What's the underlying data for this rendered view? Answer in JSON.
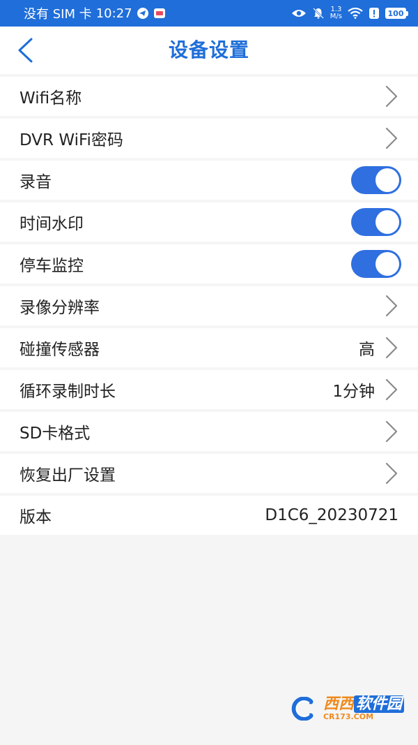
{
  "status_bar": {
    "carrier": "没有 SIM 卡",
    "time": "10:27",
    "speed_value": "1.3",
    "speed_unit": "M/s",
    "battery": "100",
    "icons": [
      "app-icon-telegram",
      "app-icon-message",
      "eye-icon",
      "bell-off-icon",
      "wifi-icon",
      "alert-icon",
      "battery-icon"
    ]
  },
  "header": {
    "title": "设备设置",
    "back_icon": "chevron-left-icon"
  },
  "settings": [
    {
      "label": "Wifi名称",
      "kind": "nav",
      "value": ""
    },
    {
      "label": "DVR WiFi密码",
      "kind": "nav",
      "value": ""
    },
    {
      "label": "录音",
      "kind": "toggle",
      "on": true
    },
    {
      "label": "时间水印",
      "kind": "toggle",
      "on": true
    },
    {
      "label": "停车监控",
      "kind": "toggle",
      "on": true
    },
    {
      "label": "录像分辨率",
      "kind": "nav",
      "value": ""
    },
    {
      "label": "碰撞传感器",
      "kind": "nav",
      "value": "高"
    },
    {
      "label": "循环录制时长",
      "kind": "nav",
      "value": "1分钟"
    },
    {
      "label": "SD卡格式",
      "kind": "nav",
      "value": ""
    },
    {
      "label": "恢复出厂设置",
      "kind": "nav",
      "value": ""
    },
    {
      "label": "版本",
      "kind": "info",
      "value": "D1C6_20230721"
    }
  ],
  "watermark": {
    "brand_a": "西西",
    "brand_b": "软件园",
    "domain": "CR173.COM"
  },
  "colors": {
    "accent": "#1f6ed9",
    "toggle_on": "#2f6fe0",
    "background": "#f5f5f5",
    "row_bg": "#ffffff",
    "text": "#222222"
  }
}
